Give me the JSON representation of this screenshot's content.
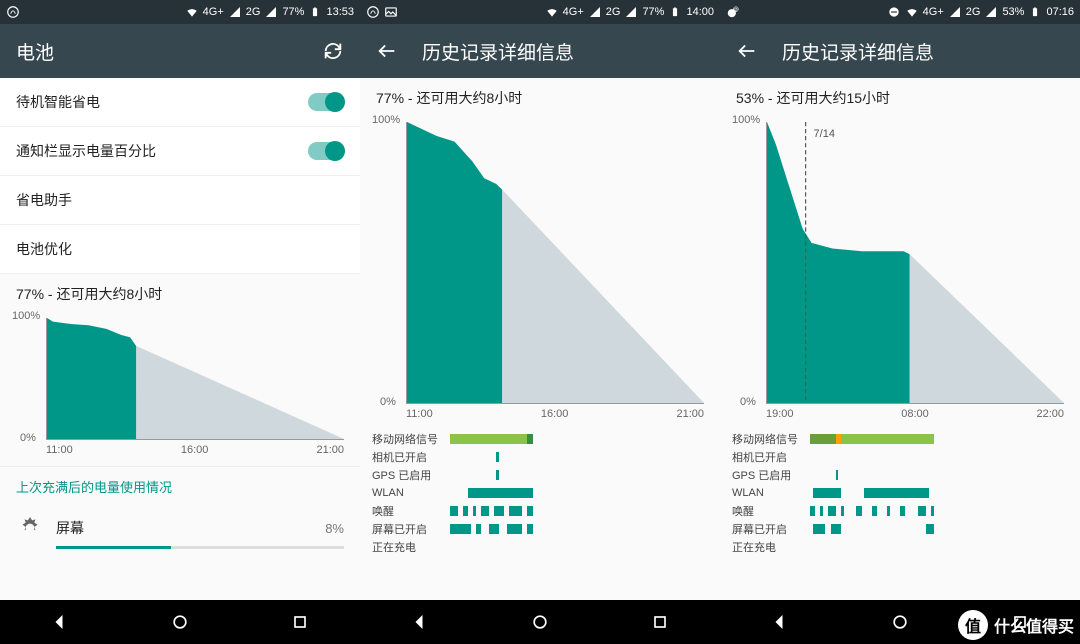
{
  "screens": [
    {
      "status": {
        "left_icon": "uc-browser",
        "network1": "4G+",
        "network2": "2G",
        "battery_pct": "77%",
        "time": "13:53"
      },
      "appbar": {
        "back": false,
        "title": "电池",
        "refresh": true
      },
      "settings": [
        {
          "label": "待机智能省电",
          "toggle": true
        },
        {
          "label": "通知栏显示电量百分比",
          "toggle": true
        },
        {
          "label": "省电助手",
          "toggle": null
        },
        {
          "label": "电池优化",
          "toggle": null
        }
      ],
      "summary": "77% - 还可用大约8小时",
      "chart": {
        "y_top": "100%",
        "y_bot": "0%",
        "x_ticks": [
          "11:00",
          "16:00",
          "21:00"
        ],
        "actual_fraction": 0.3,
        "actual_poly": "0,0 0.02,0.03 0.08,0.05 0.14,0.06 0.20,0.09 0.25,0.14 0.28,0.16 0.30,0.23 0.30,1 0,1",
        "predicted_end_x": 1.0,
        "predicted_start_y": 0.23
      },
      "link": "上次充满后的电量使用情况",
      "usage": {
        "icon": "brightness",
        "label": "屏幕",
        "pct_text": "8%",
        "pct_val": 40
      }
    },
    {
      "status": {
        "left_icon": "uc-browser",
        "extra_icon": "image",
        "network1": "4G+",
        "network2": "2G",
        "battery_pct": "77%",
        "time": "14:00"
      },
      "appbar": {
        "back": true,
        "title": "历史记录详细信息",
        "refresh": false
      },
      "summary": "77% - 还可用大约8小时",
      "chart": {
        "y_top": "100%",
        "y_bot": "0%",
        "x_ticks": [
          "11:00",
          "16:00",
          "21:00"
        ],
        "actual_fraction": 0.32,
        "actual_poly": "0,0 0.04,0.02 0.10,0.05 0.16,0.07 0.22,0.14 0.26,0.20 0.30,0.22 0.32,0.24 0.32,1 0,1",
        "predicted_end_x": 1.0,
        "predicted_start_y": 0.24
      },
      "strips": [
        {
          "label": "移动网络信号",
          "segments": [
            {
              "x": 0,
              "w": 0.3,
              "c": "#8bc34a"
            },
            {
              "x": 0.3,
              "w": 0.02,
              "c": "#388e3c"
            }
          ]
        },
        {
          "label": "相机已开启",
          "segments": [
            {
              "x": 0.18,
              "w": 0.01,
              "c": "#009688"
            }
          ]
        },
        {
          "label": "GPS 已启用",
          "segments": [
            {
              "x": 0.18,
              "w": 0.01,
              "c": "#009688"
            }
          ]
        },
        {
          "label": "WLAN",
          "segments": [
            {
              "x": 0.07,
              "w": 0.25,
              "c": "#009688"
            }
          ]
        },
        {
          "label": "唤醒",
          "segments": [
            {
              "x": 0,
              "w": 0.03,
              "c": "#009688"
            },
            {
              "x": 0.05,
              "w": 0.02,
              "c": "#009688"
            },
            {
              "x": 0.09,
              "w": 0.01,
              "c": "#009688"
            },
            {
              "x": 0.12,
              "w": 0.03,
              "c": "#009688"
            },
            {
              "x": 0.17,
              "w": 0.04,
              "c": "#009688"
            },
            {
              "x": 0.23,
              "w": 0.05,
              "c": "#009688"
            },
            {
              "x": 0.3,
              "w": 0.02,
              "c": "#009688"
            }
          ]
        },
        {
          "label": "屏幕已开启",
          "segments": [
            {
              "x": 0,
              "w": 0.08,
              "c": "#009688"
            },
            {
              "x": 0.1,
              "w": 0.02,
              "c": "#009688"
            },
            {
              "x": 0.15,
              "w": 0.04,
              "c": "#009688"
            },
            {
              "x": 0.22,
              "w": 0.06,
              "c": "#009688"
            },
            {
              "x": 0.3,
              "w": 0.02,
              "c": "#009688"
            }
          ]
        },
        {
          "label": "正在充电",
          "segments": []
        }
      ]
    },
    {
      "status": {
        "left_icon": "weibo",
        "dnd": true,
        "network1": "4G+",
        "network2": "2G",
        "battery_pct": "53%",
        "time": "07:16"
      },
      "appbar": {
        "back": true,
        "title": "历史记录详细信息",
        "refresh": false
      },
      "summary": "53% - 还可用大约15小时",
      "chart": {
        "y_top": "100%",
        "y_bot": "0%",
        "x_ticks": [
          "19:00",
          "08:00",
          "22:00"
        ],
        "actual_fraction": 0.48,
        "actual_poly": "0,0 0.03,0.08 0.06,0.18 0.09,0.28 0.12,0.38 0.15,0.43 0.22,0.45 0.32,0.46 0.40,0.46 0.46,0.46 0.48,0.47 0.48,1 0,1",
        "predicted_end_x": 1.0,
        "predicted_start_y": 0.47,
        "date_marker": {
          "x": 0.13,
          "label": "7/14"
        }
      },
      "strips": [
        {
          "label": "移动网络信号",
          "segments": [
            {
              "x": 0,
              "w": 0.1,
              "c": "#689f38"
            },
            {
              "x": 0.1,
              "w": 0.02,
              "c": "#ffa000"
            },
            {
              "x": 0.12,
              "w": 0.36,
              "c": "#8bc34a"
            }
          ]
        },
        {
          "label": "相机已开启",
          "segments": []
        },
        {
          "label": "GPS 已启用",
          "segments": [
            {
              "x": 0.1,
              "w": 0.01,
              "c": "#009688"
            }
          ]
        },
        {
          "label": "WLAN",
          "segments": [
            {
              "x": 0.01,
              "w": 0.11,
              "c": "#009688"
            },
            {
              "x": 0.21,
              "w": 0.25,
              "c": "#009688"
            }
          ]
        },
        {
          "label": "唤醒",
          "segments": [
            {
              "x": 0,
              "w": 0.02,
              "c": "#009688"
            },
            {
              "x": 0.04,
              "w": 0.01,
              "c": "#009688"
            },
            {
              "x": 0.07,
              "w": 0.03,
              "c": "#009688"
            },
            {
              "x": 0.12,
              "w": 0.01,
              "c": "#009688"
            },
            {
              "x": 0.18,
              "w": 0.02,
              "c": "#009688"
            },
            {
              "x": 0.24,
              "w": 0.02,
              "c": "#009688"
            },
            {
              "x": 0.3,
              "w": 0.01,
              "c": "#009688"
            },
            {
              "x": 0.35,
              "w": 0.02,
              "c": "#009688"
            },
            {
              "x": 0.42,
              "w": 0.03,
              "c": "#009688"
            },
            {
              "x": 0.47,
              "w": 0.01,
              "c": "#009688"
            }
          ]
        },
        {
          "label": "屏幕已开启",
          "segments": [
            {
              "x": 0.01,
              "w": 0.05,
              "c": "#009688"
            },
            {
              "x": 0.08,
              "w": 0.04,
              "c": "#009688"
            },
            {
              "x": 0.45,
              "w": 0.03,
              "c": "#009688"
            }
          ]
        },
        {
          "label": "正在充电",
          "segments": []
        }
      ]
    }
  ],
  "watermark": {
    "badge": "值",
    "text": "什么值得买"
  },
  "chart_data": [
    {
      "type": "area",
      "title": "77% - 还可用大约8小时",
      "ylabel": "%",
      "ylim": [
        0,
        100
      ],
      "x_ticks": [
        "11:00",
        "16:00",
        "21:00"
      ],
      "series": [
        {
          "name": "actual",
          "x": [
            "11:00",
            "11:30",
            "12:00",
            "12:30",
            "13:00",
            "13:30",
            "14:00"
          ],
          "values": [
            100,
            97,
            95,
            93,
            90,
            86,
            77
          ]
        },
        {
          "name": "predicted",
          "x": [
            "14:00",
            "21:00"
          ],
          "values": [
            77,
            0
          ]
        }
      ]
    },
    {
      "type": "area",
      "title": "77% - 还可用大约8小时",
      "ylabel": "%",
      "ylim": [
        0,
        100
      ],
      "x_ticks": [
        "11:00",
        "16:00",
        "21:00"
      ],
      "series": [
        {
          "name": "actual",
          "x": [
            "11:00",
            "11:30",
            "12:00",
            "12:30",
            "13:00",
            "13:30",
            "14:00"
          ],
          "values": [
            100,
            98,
            95,
            93,
            86,
            80,
            77
          ]
        },
        {
          "name": "predicted",
          "x": [
            "14:00",
            "21:00"
          ],
          "values": [
            77,
            0
          ]
        }
      ]
    },
    {
      "type": "area",
      "title": "53% - 还可用大约15小时",
      "ylabel": "%",
      "ylim": [
        0,
        100
      ],
      "x_ticks": [
        "19:00",
        "08:00",
        "22:00"
      ],
      "series": [
        {
          "name": "actual",
          "x": [
            "19:00",
            "20:00",
            "21:00",
            "22:00",
            "00:00",
            "04:00",
            "07:16"
          ],
          "values": [
            100,
            82,
            62,
            57,
            55,
            54,
            53
          ]
        },
        {
          "name": "predicted",
          "x": [
            "07:16",
            "22:00"
          ],
          "values": [
            53,
            0
          ]
        }
      ],
      "annotations": [
        {
          "x": "00:00",
          "label": "7/14"
        }
      ]
    }
  ]
}
